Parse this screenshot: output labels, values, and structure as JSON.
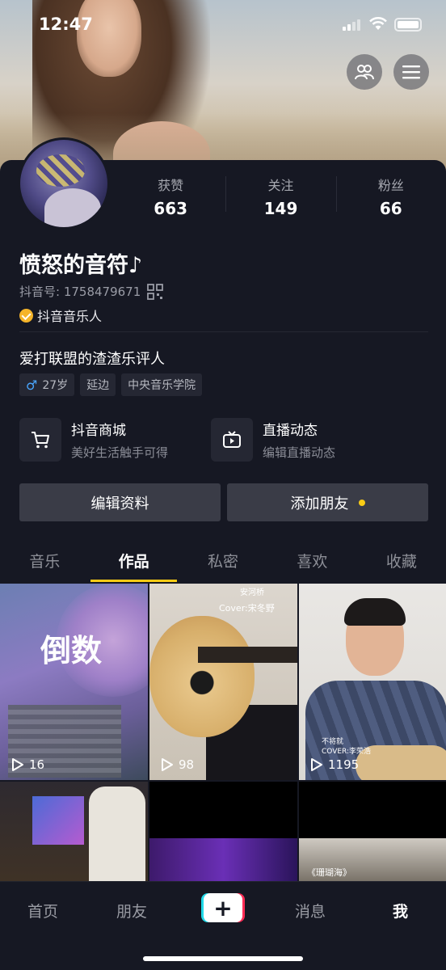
{
  "status_bar": {
    "time": "12:47"
  },
  "profile": {
    "nickname": "愤怒的音符♪",
    "douyin_id": "抖音号: 1758479671",
    "certification": "抖音音乐人",
    "bio": "爱打联盟的渣渣乐评人",
    "tags": [
      {
        "icon": "male-icon",
        "label": "27岁"
      },
      {
        "label": "延边"
      },
      {
        "label": "中央音乐学院"
      }
    ]
  },
  "stats": [
    {
      "label": "获赞",
      "value": "663"
    },
    {
      "label": "关注",
      "value": "149"
    },
    {
      "label": "粉丝",
      "value": "66"
    }
  ],
  "services": [
    {
      "icon": "cart-icon",
      "title": "抖音商城",
      "subtitle": "美好生活触手可得"
    },
    {
      "icon": "tv-icon",
      "title": "直播动态",
      "subtitle": "编辑直播动态"
    }
  ],
  "buttons": {
    "edit_profile": "编辑资料",
    "add_friends": "添加朋友"
  },
  "tabs": [
    {
      "label": "音乐",
      "active": false
    },
    {
      "label": "作品",
      "active": true
    },
    {
      "label": "私密",
      "active": false
    },
    {
      "label": "喜欢",
      "active": false
    },
    {
      "label": "收藏",
      "active": false
    }
  ],
  "videos": [
    {
      "title": "倒数",
      "plays": "16"
    },
    {
      "overlay_top": "安河桥",
      "overlay_cover": "Cover:宋冬野",
      "plays": "98"
    },
    {
      "overlay": "不将就",
      "overlay_cover": "COVER:李荣浩",
      "plays": "1195"
    },
    {
      "plays": ""
    },
    {
      "plays": ""
    },
    {
      "overlay": "《珊瑚海》",
      "plays": ""
    }
  ],
  "bottom_nav": [
    {
      "label": "首页",
      "active": false
    },
    {
      "label": "朋友",
      "active": false
    },
    {
      "label": "消息",
      "active": false
    },
    {
      "label": "我",
      "active": true
    }
  ],
  "colors": {
    "background": "#161823",
    "accent": "#facc15",
    "verified": "#f5b42a"
  }
}
